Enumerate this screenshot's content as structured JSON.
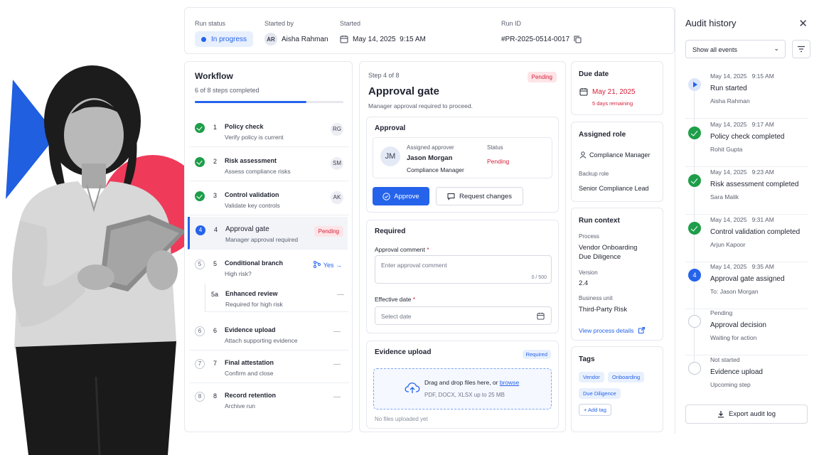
{
  "run": {
    "status_label": "Run status",
    "status_value": "In progress",
    "started_by_label": "Started by",
    "started_by_initials": "AR",
    "started_by_name": "Aisha Rahman",
    "started_label": "Started",
    "started_value": "May 14, 2025  9:15 AM",
    "run_id_label": "Run ID",
    "run_id_value": "#PR-2025-0514-0017"
  },
  "workflow": {
    "title": "Workflow",
    "subtitle": "6 of 8 steps completed",
    "progress_fraction": 0.75,
    "steps": [
      {
        "num": "1",
        "name": "Policy check",
        "desc": "Verify policy is current",
        "initials": "RG"
      },
      {
        "num": "2",
        "name": "Risk assessment",
        "desc": "Assess compliance risks",
        "initials": "SM"
      },
      {
        "num": "3",
        "name": "Control validation",
        "desc": "Validate key controls",
        "initials": "AK"
      },
      {
        "num": "4",
        "name": "Approval gate",
        "desc": "Manager approval required",
        "badge": "Pending"
      },
      {
        "num": "5",
        "name": "Conditional branch",
        "desc": "High risk?",
        "branch": "Yes →"
      },
      {
        "num": "5a",
        "name": "Enhanced review",
        "desc": "Required for high risk",
        "dash": "—"
      },
      {
        "num": "6",
        "name": "Evidence upload",
        "desc": "Attach supporting evidence",
        "dash": "—"
      },
      {
        "num": "7",
        "name": "Final attestation",
        "desc": "Confirm and close",
        "dash": "—"
      },
      {
        "num": "8",
        "name": "Record retention",
        "desc": "Archive run",
        "dash": "—"
      }
    ]
  },
  "gate": {
    "step_label": "Step 4 of 8",
    "badge": "Pending",
    "title": "Approval gate",
    "subtitle": "Manager approval required to proceed.",
    "approval_title": "Approval",
    "approver_label": "Assigned approver",
    "approver_initials": "JM",
    "approver_name": "Jason Morgan",
    "approver_role": "Compliance Manager",
    "status_label": "Status",
    "status_value": "Pending",
    "approve_btn": "Approve",
    "request_btn": "Request changes",
    "required_title": "Required",
    "comment_label": "Approval comment",
    "comment_placeholder": "Enter approval comment",
    "comment_counter": "0 / 500",
    "date_label": "Effective date",
    "date_placeholder": "Select date",
    "star": "*",
    "evidence_title": "Evidence upload",
    "evidence_badge": "Required",
    "drop_text": "Drag and drop files here, or",
    "drop_link": "browse",
    "drop_hint": "PDF, DOCX, XLSX up to 25 MB",
    "no_files": "No files uploaded yet"
  },
  "due": {
    "title": "Due date",
    "date": "May 21, 2025",
    "remaining": "5 days remaining"
  },
  "role": {
    "title": "Assigned role",
    "value": "Compliance Manager",
    "backup_label": "Backup role",
    "backup_value": "Senior Compliance Lead"
  },
  "context": {
    "title": "Run context",
    "process_label": "Process",
    "process_line1": "Vendor Onboarding",
    "process_line2": "Due Diligence",
    "version_label": "Version",
    "version_value": "2.4",
    "unit_label": "Business unit",
    "unit_value": "Third-Party Risk",
    "link": "View process details"
  },
  "tags": {
    "title": "Tags",
    "items": [
      "Vendor",
      "Onboarding",
      "Due Diligence"
    ],
    "add": "+ Add tag"
  },
  "audit": {
    "title": "Audit history",
    "filter": "Show all events",
    "events": [
      {
        "time": "May 14, 2025   9:15 AM",
        "title": "Run started",
        "person": "Aisha Rahman"
      },
      {
        "time": "May 14, 2025   9:17 AM",
        "title": "Policy check completed",
        "person": "Rohit Gupta"
      },
      {
        "time": "May 14, 2025   9:23 AM",
        "title": "Risk assessment completed",
        "person": "Sara Malik"
      },
      {
        "time": "May 14, 2025   9:31 AM",
        "title": "Control validation completed",
        "person": "Arjun Kapoor"
      },
      {
        "time": "May 14, 2025   9:35 AM",
        "title": "Approval gate assigned",
        "person": "To: Jason Morgan",
        "marker": "4"
      },
      {
        "time": "Pending",
        "title": "Approval decision",
        "person": "Waiting for action"
      },
      {
        "time": "Not started",
        "title": "Evidence upload",
        "person": "Upcoming step"
      }
    ],
    "export": "Export audit log"
  },
  "colors": {
    "accent": "#2563eb",
    "success": "#1e9e4a",
    "danger": "#d6213a",
    "hero_blue": "#1f5fe0",
    "hero_red": "#f03a5a"
  }
}
